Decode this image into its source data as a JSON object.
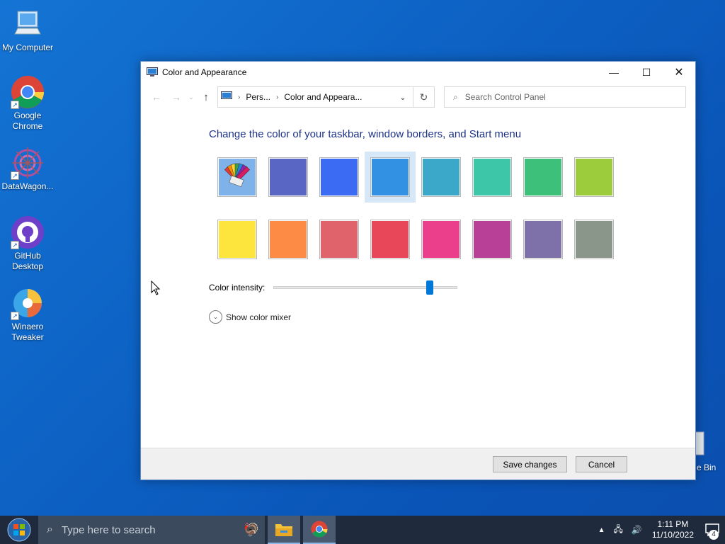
{
  "desktop": {
    "icons": [
      {
        "label": "My Computer"
      },
      {
        "label": "Google\nChrome"
      },
      {
        "label": "DataWagon..."
      },
      {
        "label": "GitHub\nDesktop"
      },
      {
        "label": "Winaero\nTweaker"
      }
    ],
    "recycle_bin_partial": "e Bin"
  },
  "window": {
    "title": "Color and Appearance",
    "controls": {
      "minimize": "—",
      "maximize": "☐",
      "close": "✕"
    },
    "breadcrumb": [
      "Pers...",
      "Color and Appeara..."
    ],
    "search_placeholder": "Search Control Panel",
    "heading": "Change the color of your taskbar, window borders, and Start menu",
    "swatches_row1": [
      {
        "name": "automatic",
        "color": "#7fb2e8"
      },
      {
        "name": "slate-blue",
        "color": "#5966c3"
      },
      {
        "name": "blue",
        "color": "#3a6bf2"
      },
      {
        "name": "sky",
        "color": "#3391e3",
        "selected": true
      },
      {
        "name": "teal-blue",
        "color": "#3ba8c9"
      },
      {
        "name": "turquoise",
        "color": "#3dc6a8"
      },
      {
        "name": "green",
        "color": "#3cc07a"
      },
      {
        "name": "lime",
        "color": "#9ccc3c"
      }
    ],
    "swatches_row2": [
      {
        "name": "yellow",
        "color": "#fde53e"
      },
      {
        "name": "orange",
        "color": "#fd8b45"
      },
      {
        "name": "salmon",
        "color": "#e0626b"
      },
      {
        "name": "red",
        "color": "#e8475a"
      },
      {
        "name": "pink",
        "color": "#ec3f8b"
      },
      {
        "name": "magenta",
        "color": "#b84197"
      },
      {
        "name": "lavender",
        "color": "#7e70a8"
      },
      {
        "name": "gray",
        "color": "#8b968b"
      }
    ],
    "intensity_label": "Color intensity:",
    "intensity_value": 0.85,
    "mixer_label": "Show color mixer",
    "save_label": "Save changes",
    "cancel_label": "Cancel"
  },
  "taskbar": {
    "search_placeholder": "Type here to search",
    "time": "1:11 PM",
    "date": "11/10/2022",
    "notification_count": "4"
  }
}
